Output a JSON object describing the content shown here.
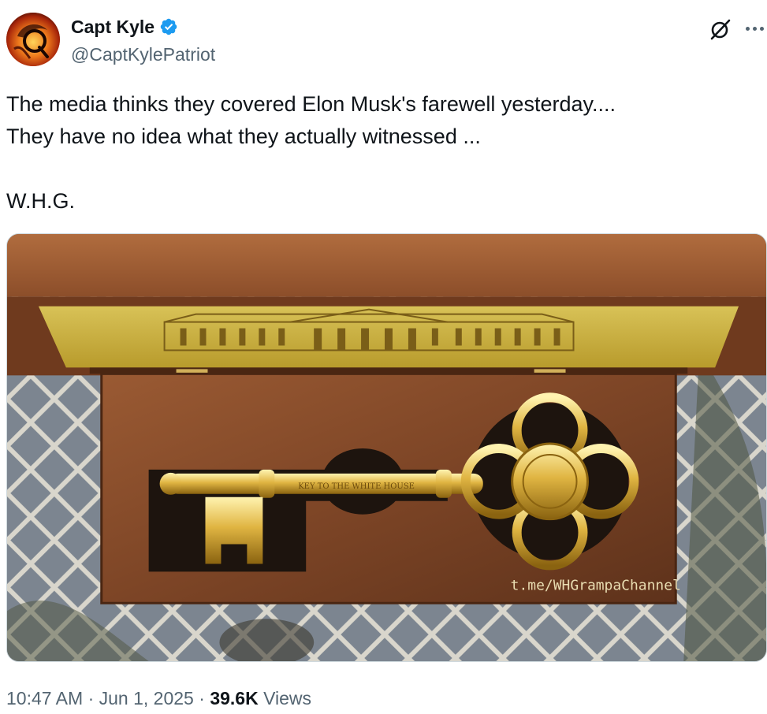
{
  "author": {
    "display_name": "Capt Kyle",
    "handle": "@CaptKylePatriot",
    "verified_icon": "verified-badge-icon",
    "avatar_icon": "phoenix-q-avatar"
  },
  "actions": {
    "grok_icon": "grok-icon",
    "more_icon": "more-dots-icon"
  },
  "tweet": {
    "lines": [
      "The media thinks they covered Elon Musk's farewell yesterday....",
      "They have no idea what they actually witnessed ...",
      "",
      "W.H.G."
    ]
  },
  "media": {
    "watermark": "t.me/WHGrampaChannel",
    "key_engraving": "KEY TO THE WHITE HOUSE"
  },
  "meta": {
    "time": "10:47 AM",
    "sep1": " · ",
    "date": "Jun 1, 2025",
    "sep2": " · ",
    "views_count": "39.6K",
    "views_label": " Views"
  },
  "colors": {
    "verified_blue": "#1d9bf0",
    "text_primary": "#0f1419",
    "text_secondary": "#536471"
  }
}
